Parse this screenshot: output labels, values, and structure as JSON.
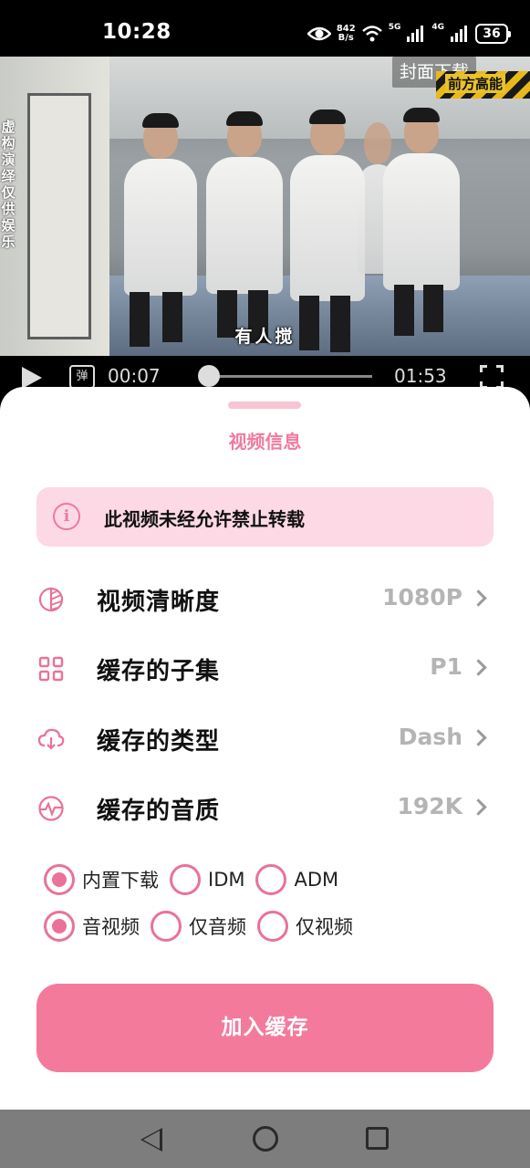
{
  "status_bar": {
    "time": "10:28",
    "net_speed_value": "842",
    "net_speed_unit": "B/s",
    "signal_1_label": "5G",
    "signal_2_label": "4G",
    "battery": "36",
    "icons": [
      "eye-icon",
      "wifi-icon",
      "signal-icon",
      "signal-icon",
      "battery-icon"
    ]
  },
  "video": {
    "side_text": "虚构演绎 仅供娱乐",
    "cover_download": "封面下载",
    "hazard_tag": "前方高能",
    "subtitle": "有人搅",
    "danmaku_glyph": "弹",
    "time_current": "00:07",
    "time_total": "01:53",
    "progress_fraction": 0.06
  },
  "sheet": {
    "title": "视频信息",
    "notice": "此视频未经允许禁止转载",
    "settings": [
      {
        "label": "视频清晰度",
        "value": "1080P",
        "icon": "resolution-icon"
      },
      {
        "label": "缓存的子集",
        "value": "P1",
        "icon": "grid-icon"
      },
      {
        "label": "缓存的类型",
        "value": "Dash",
        "icon": "cloud-download-icon"
      },
      {
        "label": "缓存的音质",
        "value": "192K",
        "icon": "waveform-icon"
      }
    ],
    "downloader_options": [
      {
        "label": "内置下载",
        "checked": true
      },
      {
        "label": "IDM",
        "checked": false
      },
      {
        "label": "ADM",
        "checked": false
      }
    ],
    "content_options": [
      {
        "label": "音视频",
        "checked": true
      },
      {
        "label": "仅音频",
        "checked": false
      },
      {
        "label": "仅视频",
        "checked": false
      }
    ],
    "add_button": "加入缓存"
  },
  "colors": {
    "accent": "#ea7297",
    "button": "#f47a9c",
    "notice_bg": "#fcd9e4",
    "value_gray": "#b4b4b4"
  }
}
